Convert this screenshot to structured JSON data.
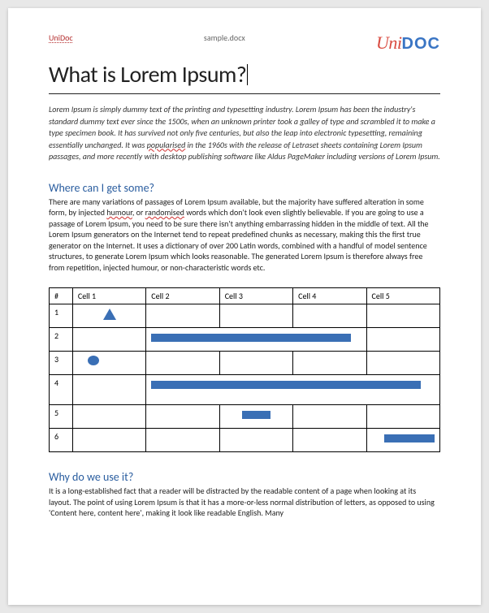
{
  "header": {
    "left": "UniDoc",
    "center": "sample.docx",
    "logo_uni": "Uni",
    "logo_doc": "DOC"
  },
  "title": "What is Lorem Ipsum?",
  "intro": "Lorem Ipsum is simply dummy text of the printing and typesetting industry. Lorem Ipsum has been the industry's standard dummy text ever since the 1500s, when an unknown printer took a galley of type and scrambled it to make a type specimen book. It has survived not only five centuries, but also the leap into electronic typesetting, remaining essentially unchanged. It was popularised in the 1960s with the release of Letraset sheets containing Lorem Ipsum passages, and more recently with desktop publishing software like Aldus PageMaker including versions of Lorem Ipsum.",
  "section1": {
    "heading": "Where can I get some?",
    "body": "There are many variations of passages of Lorem Ipsum available, but the majority have suffered alteration in some form, by injected humour, or randomised words which don't look even slightly believable. If you are going to use a passage of Lorem Ipsum, you need to be sure there isn't anything embarrassing hidden in the middle of text. All the Lorem Ipsum generators on the Internet tend to repeat predefined chunks as necessary, making this the first true generator on the Internet. It uses a dictionary of over 200 Latin words, combined with a handful of model sentence structures, to generate Lorem Ipsum which looks reasonable. The generated Lorem Ipsum is therefore always free from repetition, injected humour, or non-characteristic words etc."
  },
  "table": {
    "headers": [
      "#",
      "Cell 1",
      "Cell 2",
      "Cell 3",
      "Cell 4",
      "Cell 5"
    ],
    "rows": [
      {
        "num": "1",
        "shape": "triangle",
        "bar": null
      },
      {
        "num": "2",
        "shape": null,
        "bar": {
          "start": 2,
          "span": 3
        }
      },
      {
        "num": "3",
        "shape": "circle",
        "bar": null
      },
      {
        "num": "4",
        "shape": null,
        "bar": {
          "start": 2,
          "span": 4
        }
      },
      {
        "num": "5",
        "shape": null,
        "bar": {
          "start": 3,
          "span": 1,
          "short": true
        }
      },
      {
        "num": "6",
        "shape": null,
        "bar": {
          "start": 5,
          "span": 1,
          "offset": true
        }
      }
    ]
  },
  "section2": {
    "heading": "Why do we use it?",
    "body": "It is a long-established fact that a reader will be distracted by the readable content of a page when looking at its layout. The point of using Lorem Ipsum is that it has a more-or-less normal distribution of letters, as opposed to using 'Content here, content here', making it look like readable English. Many"
  }
}
